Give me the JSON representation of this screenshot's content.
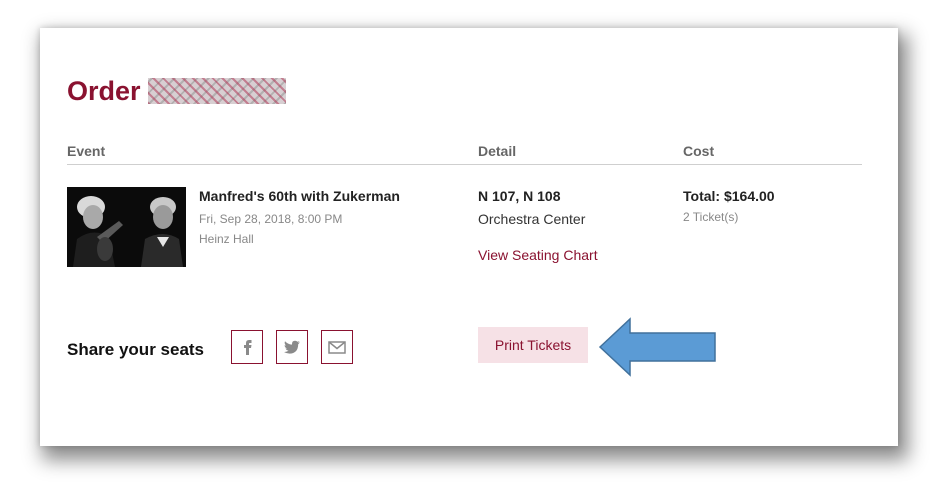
{
  "order": {
    "title": "Order"
  },
  "columns": {
    "event": "Event",
    "detail": "Detail",
    "cost": "Cost"
  },
  "event": {
    "name": "Manfred's 60th with Zukerman",
    "date": "Fri, Sep 28, 2018, 8:00 PM",
    "venue": "Heinz Hall"
  },
  "detail": {
    "seats": "N 107, N 108",
    "section": "Orchestra Center",
    "seating_chart_link": "View Seating Chart"
  },
  "cost": {
    "total": "Total: $164.00",
    "tickets": "2 Ticket(s)"
  },
  "share": {
    "label": "Share your seats",
    "icons": [
      "facebook-icon",
      "twitter-icon",
      "email-icon"
    ]
  },
  "actions": {
    "print_label": "Print Tickets"
  },
  "colors": {
    "brand": "#8a1230",
    "print_button_bg": "#f6e1e6",
    "annotation_arrow": "#5b9bd5"
  }
}
